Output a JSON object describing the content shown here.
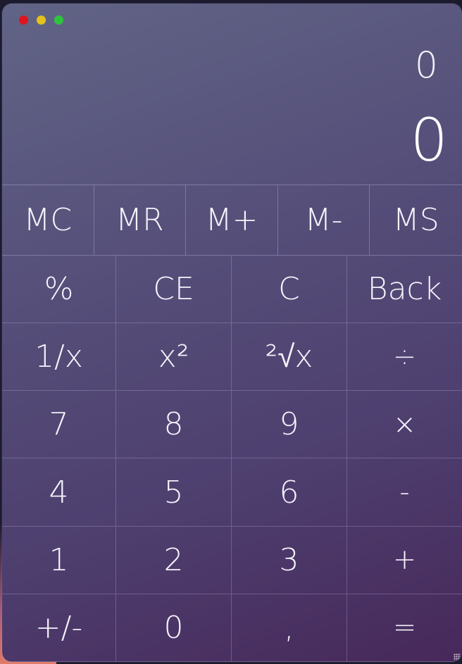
{
  "display": {
    "expression": "0",
    "result": "0"
  },
  "memory": [
    "MC",
    "MR",
    "M+",
    "M-",
    "MS"
  ],
  "keys": [
    {
      "label": "%",
      "name": "percent-button"
    },
    {
      "label": "CE",
      "name": "clear-entry-button"
    },
    {
      "label": "C",
      "name": "clear-button"
    },
    {
      "label": "Back",
      "name": "backspace-button"
    },
    {
      "label": "1/x",
      "name": "reciprocal-button"
    },
    {
      "label": "x²",
      "name": "square-button"
    },
    {
      "label": "²√x",
      "name": "square-root-button"
    },
    {
      "label": "÷",
      "name": "divide-button"
    },
    {
      "label": "7",
      "name": "digit-7-button"
    },
    {
      "label": "8",
      "name": "digit-8-button"
    },
    {
      "label": "9",
      "name": "digit-9-button"
    },
    {
      "label": "×",
      "name": "multiply-button"
    },
    {
      "label": "4",
      "name": "digit-4-button"
    },
    {
      "label": "5",
      "name": "digit-5-button"
    },
    {
      "label": "6",
      "name": "digit-6-button"
    },
    {
      "label": "-",
      "name": "subtract-button"
    },
    {
      "label": "1",
      "name": "digit-1-button"
    },
    {
      "label": "2",
      "name": "digit-2-button"
    },
    {
      "label": "3",
      "name": "digit-3-button"
    },
    {
      "label": "+",
      "name": "add-button"
    },
    {
      "label": "+/-",
      "name": "negate-button"
    },
    {
      "label": "0",
      "name": "digit-0-button"
    },
    {
      "label": ",",
      "name": "decimal-separator-button"
    },
    {
      "label": "=",
      "name": "equals-button"
    }
  ],
  "colors": {
    "close": "#e0151c",
    "minimize": "#e4c21a",
    "maximize": "#2fc43e"
  }
}
